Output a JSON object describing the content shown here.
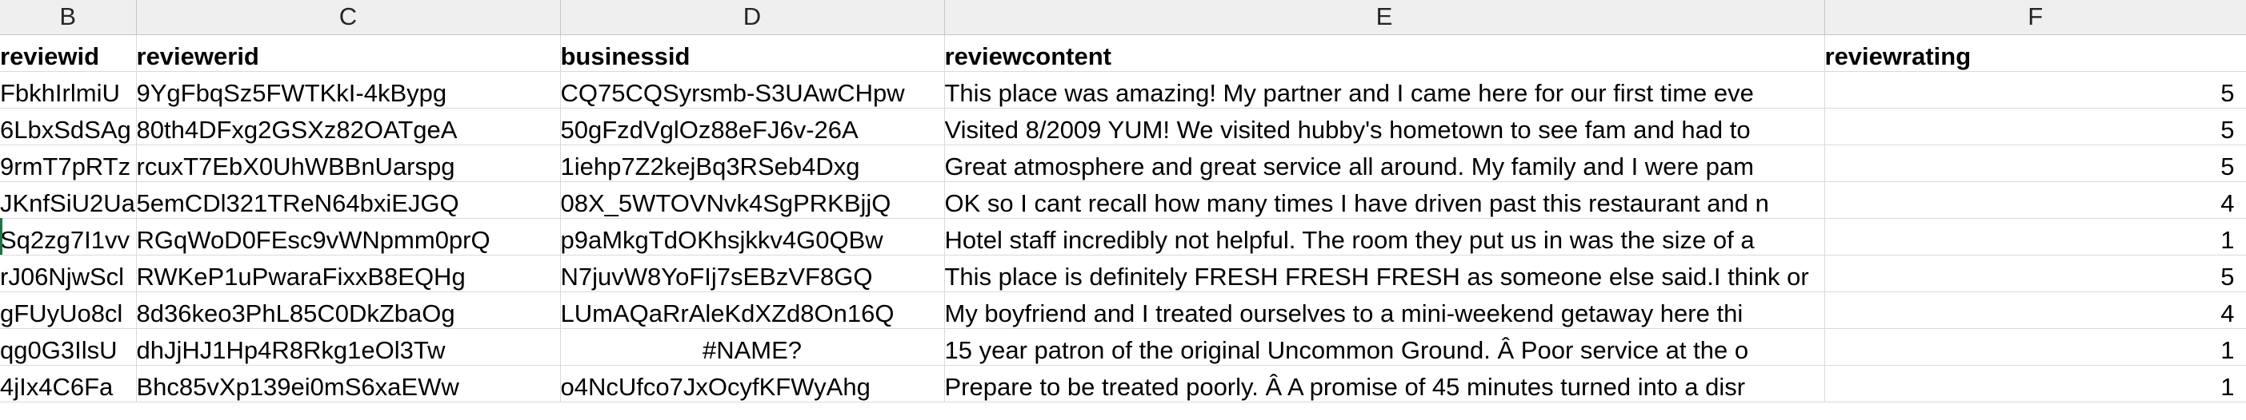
{
  "columns": [
    "B",
    "C",
    "D",
    "E",
    "F"
  ],
  "header": {
    "reviewid": "reviewid",
    "reviewerid": "reviewerid",
    "businessid": "businessid",
    "reviewcontent": "reviewcontent",
    "reviewrating": "reviewrating"
  },
  "rows": [
    {
      "reviewid": "FbkhIrlmiU",
      "reviewerid": "9YgFbqSz5FWTKkI-4kBypg",
      "businessid": "CQ75CQSyrsmb-S3UAwCHpw",
      "reviewcontent": "This place was amazing! My partner and I came here for our first time eve",
      "reviewrating": "5"
    },
    {
      "reviewid": "6LbxSdSAg",
      "reviewerid": "80th4DFxg2GSXz82OATgeA",
      "businessid": "50gFzdVglOz88eFJ6v-26A",
      "reviewcontent": "Visited 8/2009 YUM! We visited hubby's hometown to see fam and had to",
      "reviewrating": "5"
    },
    {
      "reviewid": "9rmT7pRTz",
      "reviewerid": "rcuxT7EbX0UhWBBnUarspg",
      "businessid": "1iehp7Z2kejBq3RSeb4Dxg",
      "reviewcontent": "Great atmosphere and great service all around. My family and I were pam",
      "reviewrating": "5"
    },
    {
      "reviewid": "JKnfSiU2Ua",
      "reviewerid": "5emCDl321TReN64bxiEJGQ",
      "businessid": "08X_5WTOVNvk4SgPRKBjjQ",
      "reviewcontent": "OK so I cant recall how many times I have driven past this restaurant and n",
      "reviewrating": "4"
    },
    {
      "reviewid": "Sq2zg7I1vv",
      "reviewerid": "RGqWoD0FEsc9vWNpmm0prQ",
      "businessid": "p9aMkgTdOKhsjkkv4G0QBw",
      "reviewcontent": "Hotel staff incredibly not helpful. The room they put us in was the size of a",
      "reviewrating": "1"
    },
    {
      "reviewid": "rJ06NjwScl",
      "reviewerid": "RWKeP1uPwaraFixxB8EQHg",
      "businessid": "N7juvW8YoFIj7sEBzVF8GQ",
      "reviewcontent": "This place is definitely FRESH FRESH FRESH as someone else said.I think or",
      "reviewrating": "5"
    },
    {
      "reviewid": "gFUyUo8cl",
      "reviewerid": "8d36keo3PhL85C0DkZbaOg",
      "businessid": "LUmAQaRrAleKdXZd8On16Q",
      "reviewcontent": "My boyfriend and I treated ourselves to a mini-weekend getaway here thi",
      "reviewrating": "4"
    },
    {
      "reviewid": "qg0G3IlsU",
      "reviewerid": "dhJjHJ1Hp4R8Rkg1eOl3Tw",
      "businessid": "#NAME?",
      "reviewcontent": "15 year patron of the original Uncommon Ground. Â Poor service at the o",
      "reviewrating": "1"
    },
    {
      "reviewid": "4jIx4C6Fa",
      "reviewerid": "Bhc85vXp139ei0mS6xaEWw",
      "businessid": "o4NcUfco7JxOcyfKFWyAhg",
      "reviewcontent": "Prepare to be treated poorly. Â A promise of 45 minutes turned into a disr",
      "reviewrating": "1"
    }
  ],
  "colors": {
    "header_bg": "#efefef",
    "grid_line": "#d9d9d9",
    "selection_accent": "#217346"
  }
}
